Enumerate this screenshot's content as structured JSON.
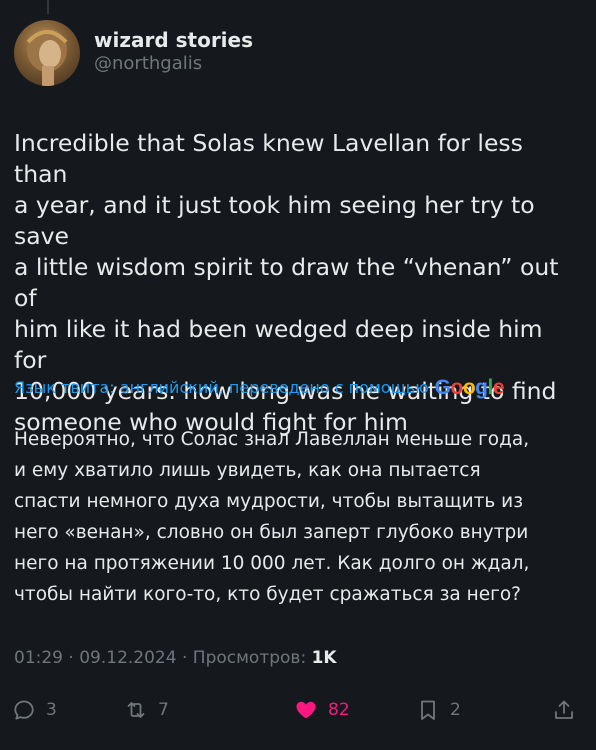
{
  "author": {
    "display_name": "wizard stories",
    "handle": "@northgalis"
  },
  "tweet": {
    "text": "Incredible that Solas knew Lavellan for less than\na year, and it just took him seeing her try to save\na little wisdom spirit to draw the “vhenan” out of\nhim like it had been wedged deep inside him for\n10,000 years. how long was he waiting to find\nsomeone who would fight for him"
  },
  "translation": {
    "label": "Язык твита: английский, переведено с помощью",
    "provider": "Google",
    "text": "Невероятно, что Солас знал Лавеллан меньше года,\nи ему хватило лишь увидеть, как она пытается\nспасти немного духа мудрости, чтобы вытащить из\nнего «венан», словно он был заперт глубоко внутри\nнего на протяжении 10 000 лет. Как долго он ждал,\nчтобы найти кого-то, кто будет сражаться за него?"
  },
  "meta": {
    "time": "01:29",
    "date": "09.12.2024",
    "views_label": "Просмотров:",
    "views_count": "1K"
  },
  "actions": {
    "replies": "3",
    "retweets": "7",
    "likes": "82",
    "bookmarks": "2"
  },
  "colors": {
    "background": "#15181c",
    "text": "#e7e9ea",
    "secondary": "#71767b",
    "link": "#1d9bf0",
    "like": "#f91880"
  }
}
